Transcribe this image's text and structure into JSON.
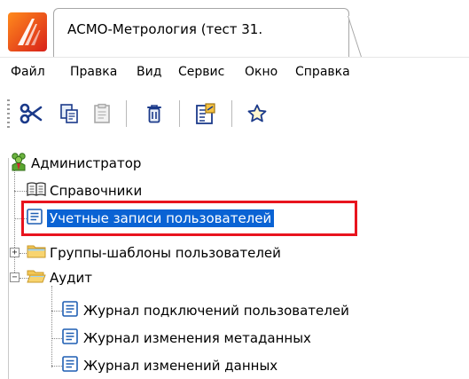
{
  "window": {
    "tab_title": "АСМО-Метрология (тест 31."
  },
  "menu": {
    "items": [
      "Файл",
      "Правка",
      "Вид",
      "Сервис",
      "Окно",
      "Справка"
    ]
  },
  "toolbar": {
    "buttons": [
      "cut-icon",
      "copy-icon",
      "paste-icon",
      "delete-icon",
      "properties-icon",
      "favorite-icon"
    ]
  },
  "tree": {
    "root": {
      "label": "Администратор",
      "icon": "users-group-icon"
    },
    "items": [
      {
        "label": "Справочники",
        "icon": "book-icon"
      },
      {
        "label": "Учетные записи пользователей",
        "icon": "form-icon",
        "selected": true
      },
      {
        "label": "Группы-шаблоны пользователей",
        "icon": "folder-icon",
        "expander": "+"
      },
      {
        "label": "Аудит",
        "icon": "folder-open-icon",
        "expander": "−"
      },
      {
        "label": "Журнал подключений пользователей",
        "icon": "form-icon"
      },
      {
        "label": "Журнал изменения метаданных",
        "icon": "form-icon"
      },
      {
        "label": "Журнал изменений данных",
        "icon": "form-icon"
      }
    ]
  },
  "colors": {
    "selection": "#0a63d4",
    "highlight": "#e8141e",
    "logo": "#e84a1c",
    "folder": "#f3c756"
  }
}
